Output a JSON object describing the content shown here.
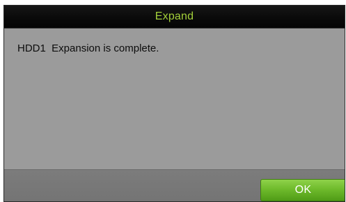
{
  "dialog": {
    "title": "Expand",
    "message": "HDD1  Expansion is complete.",
    "ok_label": "OK"
  },
  "colors": {
    "title_text": "#a3d03a",
    "titlebar_bg": "#0a0a0a",
    "body_bg": "#9b9b9b",
    "footer_bg": "#787878",
    "ok_button_bg": "#6fbb2c"
  }
}
